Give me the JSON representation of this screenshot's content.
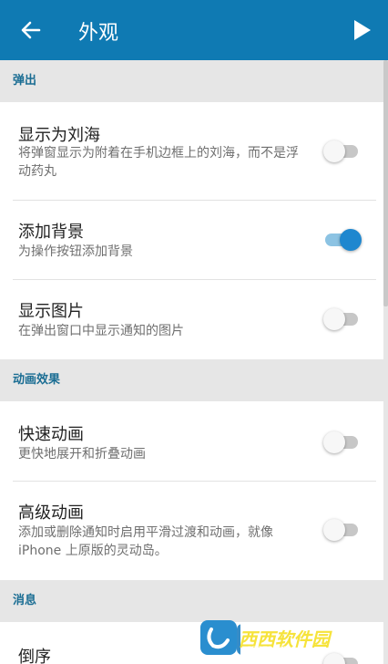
{
  "appbar": {
    "title": "外观",
    "back_icon": "arrow-left-icon",
    "play_icon": "play-icon",
    "background": "#0f7ab3"
  },
  "sections": [
    {
      "header": "弹出",
      "items": [
        {
          "title": "显示为刘海",
          "subtitle": "将弹窗显示为附着在手机边框上的刘海，而不是浮动药丸",
          "enabled": false
        },
        {
          "title": "添加背景",
          "subtitle": "为操作按钮添加背景",
          "enabled": true
        },
        {
          "title": "显示图片",
          "subtitle": "在弹出窗口中显示通知的图片",
          "enabled": false
        }
      ]
    },
    {
      "header": "动画效果",
      "items": [
        {
          "title": "快速动画",
          "subtitle": "更快地展开和折叠动画",
          "enabled": false
        },
        {
          "title": "高级动画",
          "subtitle": "添加或删除通知时启用平滑过渡和动画，就像 iPhone 上原版的灵动岛。",
          "enabled": false
        }
      ]
    },
    {
      "header": "消息",
      "items": [
        {
          "title": "倒序",
          "enabled": false
        }
      ]
    }
  ],
  "colors": {
    "accent": "#1e87cf",
    "section_header": "#1a6d93"
  },
  "watermark": {
    "text": "西西软件园",
    "sub": "CR173.COM"
  }
}
